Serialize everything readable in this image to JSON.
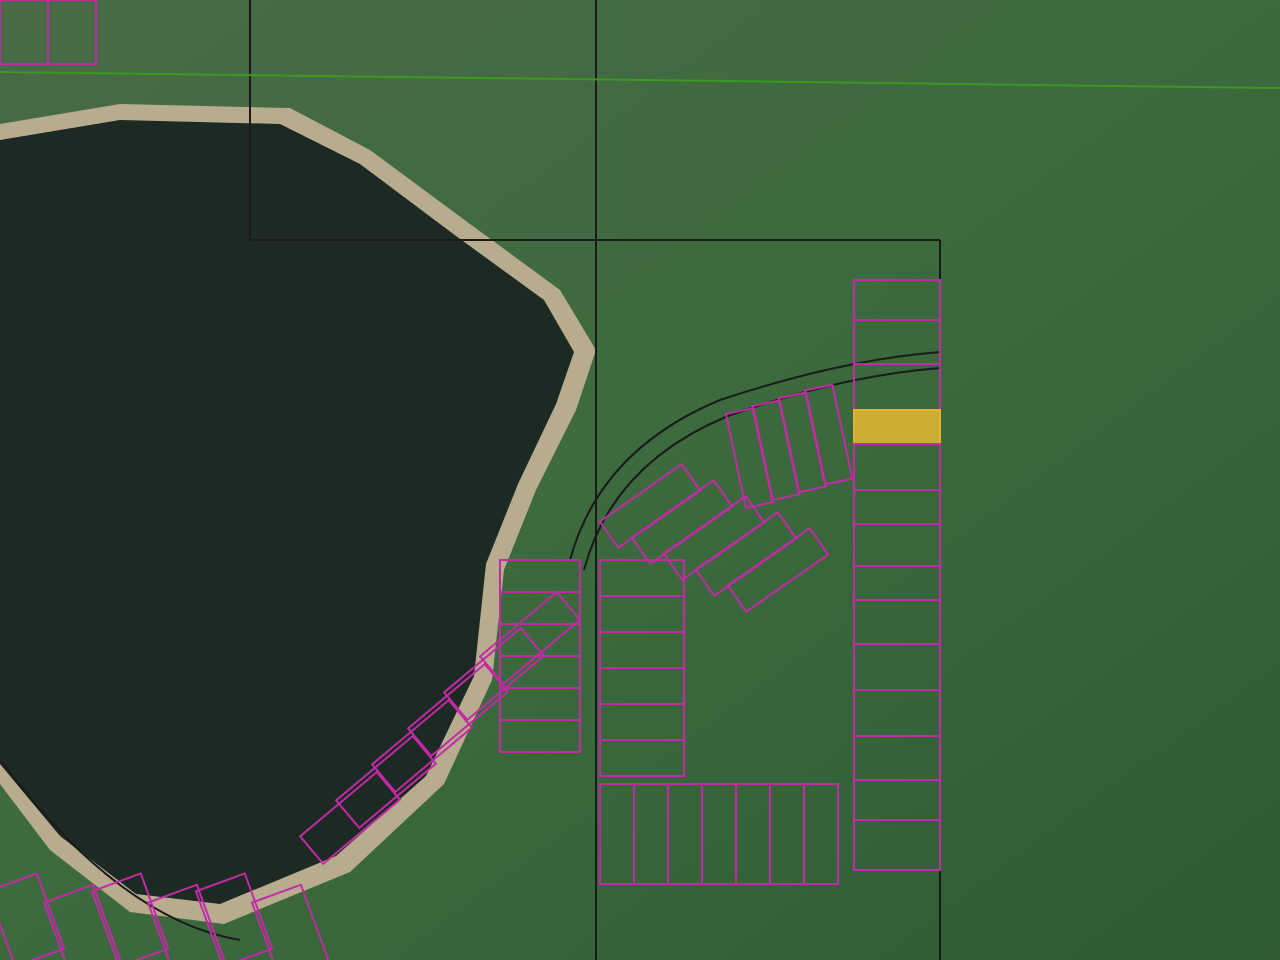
{
  "map": {
    "parcels": [
      {
        "selected": false
      },
      {
        "selected": false
      },
      {
        "selected": false
      },
      {
        "selected": true
      },
      {
        "selected": false
      },
      {
        "selected": false
      },
      {
        "selected": false
      },
      {
        "selected": false
      },
      {
        "selected": false
      },
      {
        "selected": false
      },
      {
        "selected": false
      },
      {
        "selected": false
      },
      {
        "selected": false
      },
      {
        "selected": false
      }
    ]
  }
}
